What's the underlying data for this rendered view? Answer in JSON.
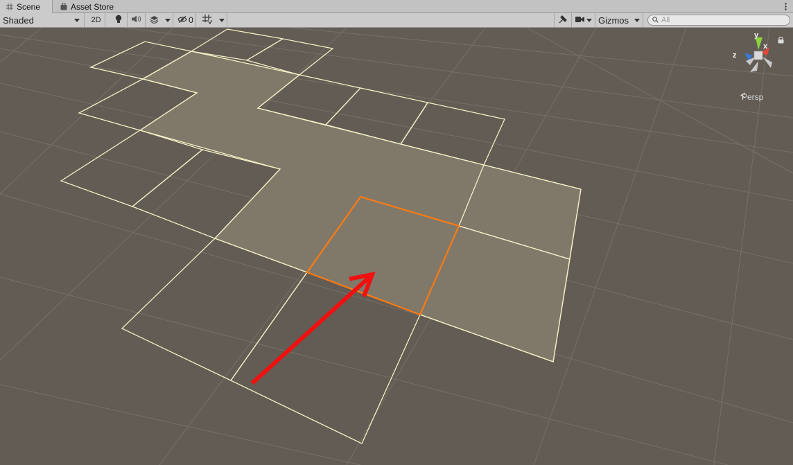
{
  "tabs": [
    {
      "label": "Scene",
      "icon": "grid-icon",
      "active": true
    },
    {
      "label": "Asset Store",
      "icon": "bag-icon",
      "active": false
    }
  ],
  "toolbar": {
    "draw_mode": "Shaded",
    "mode_2d": "2D",
    "hidden_count": "0",
    "gizmos_label": "Gizmos",
    "search_placeholder": "All"
  },
  "gizmo": {
    "y_label": "y",
    "x_label": "x",
    "z_label": "z",
    "projection": "Persp"
  },
  "colors": {
    "scene_bg": "#625c54",
    "tile_fill": "#80796a",
    "tile_outline": "#f5efc6",
    "selected_outline": "#ff7a10",
    "arrow": "#f01010"
  }
}
